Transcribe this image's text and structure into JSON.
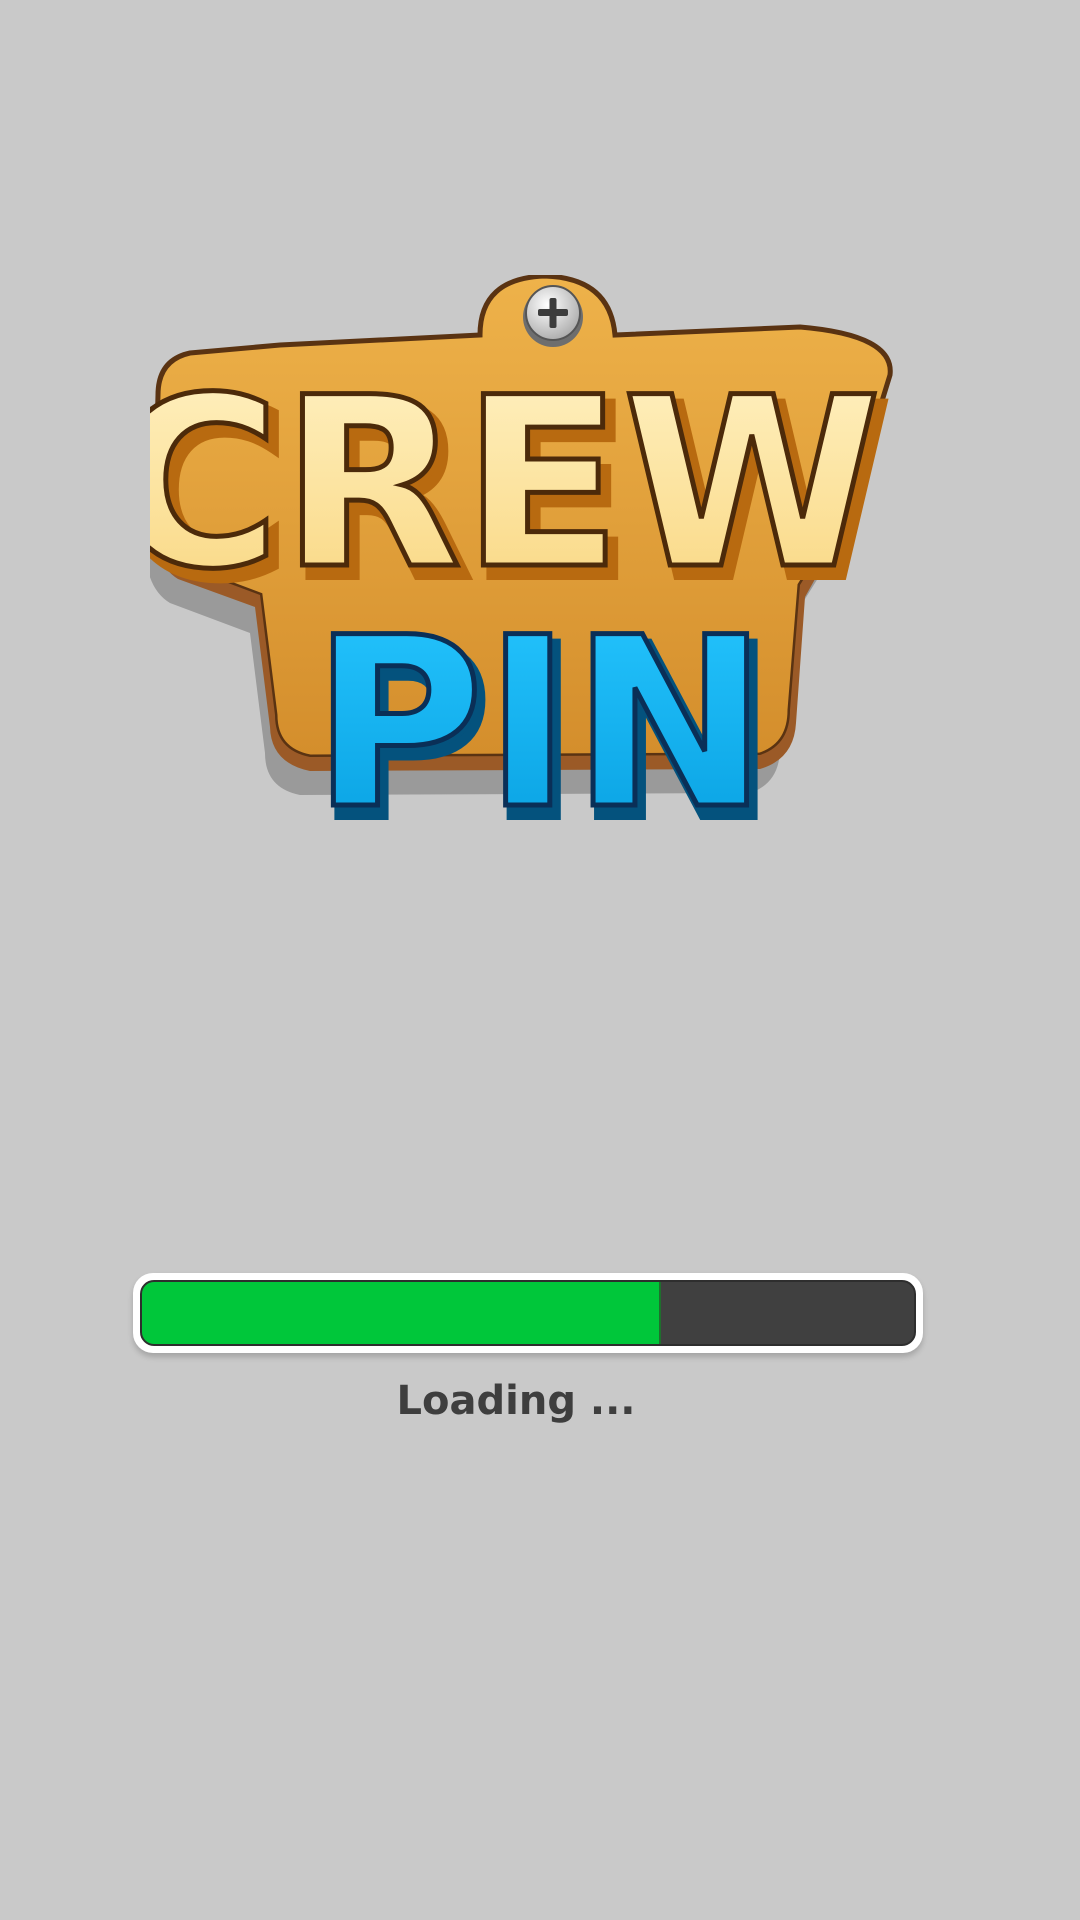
{
  "logo": {
    "line1": "CREW",
    "line2": "PIN"
  },
  "loading": {
    "progress_percent": 67,
    "label": "Loading ...",
    "fill_color": "#00c73a",
    "track_color": "#404040"
  },
  "colors": {
    "background": "#c9c9c9",
    "logo_wood": "#e2a33b",
    "logo_crew": "#fde3a0",
    "logo_pin": "#17b4f0"
  }
}
